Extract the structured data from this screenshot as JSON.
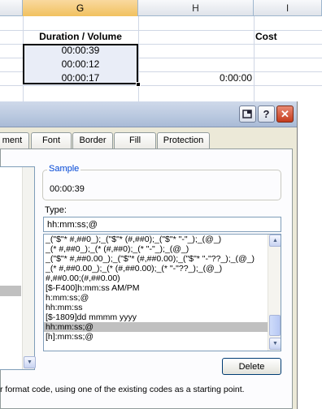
{
  "sheet": {
    "columns": [
      "G",
      "H",
      "I"
    ],
    "g_header": "Duration / Volume",
    "i_header": "Cost",
    "g_values": [
      "00:00:39",
      "00:00:12",
      "00:00:17"
    ],
    "h_value": "0:00:00"
  },
  "titlebar": {
    "help": "?",
    "close": "✕"
  },
  "tabs": [
    "ment",
    "Font",
    "Border",
    "Fill",
    "Protection"
  ],
  "sample": {
    "legend": "Sample",
    "value": "00:00:39"
  },
  "type": {
    "label": "Type:",
    "value": "hh:mm:ss;@"
  },
  "codes": [
    "_(\"$\"* #,##0_);_(\"$\"* (#,##0);_(\"$\"* \"-\"_);_(@_)",
    "_(* #,##0_);_(* (#,##0);_(* \"-\"_);_(@_)",
    "_(\"$\"* #,##0.00_);_(\"$\"* (#,##0.00);_(\"$\"* \"-\"??_);_(@_)",
    "_(* #,##0.00_);_(* (#,##0.00);_(* \"-\"??_);_(@_)",
    "#,##0.00;(#,##0.00)",
    "[$-F400]h:mm:ss AM/PM",
    "h:mm:ss;@",
    "hh:mm:ss",
    "[$-1809]dd mmmm yyyy",
    "hh:mm:ss;@",
    "[h]:mm:ss;@"
  ],
  "selected_code_index": 9,
  "delete_label": "Delete",
  "hint": "r format code, using one of the existing codes as a starting point."
}
